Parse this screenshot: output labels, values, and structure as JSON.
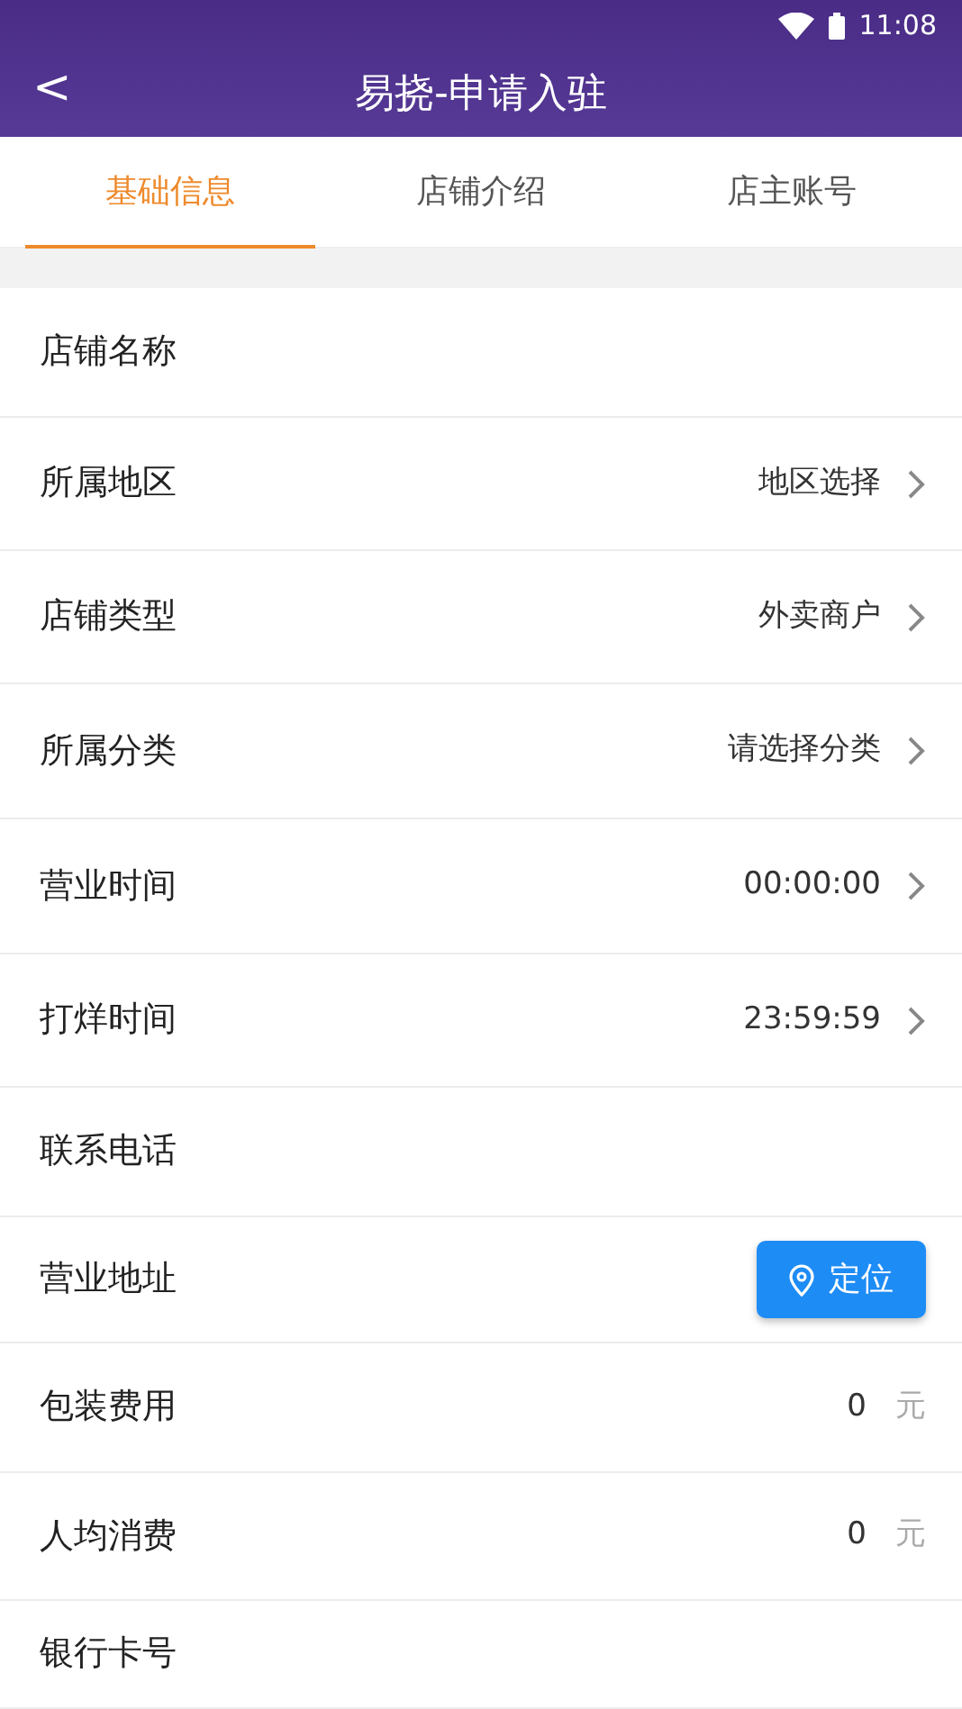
{
  "status_bar": {
    "time": "11:08"
  },
  "header": {
    "back": "<",
    "title": "易挠-申请入驻"
  },
  "tabs": [
    {
      "label": "基础信息",
      "selected": true
    },
    {
      "label": "店铺介绍",
      "selected": false
    },
    {
      "label": "店主账号",
      "selected": false
    }
  ],
  "rows": [
    {
      "kind": "input",
      "label": "店铺名称"
    },
    {
      "kind": "select",
      "label": "所属地区",
      "value": "地区选择"
    },
    {
      "kind": "select",
      "label": "店铺类型",
      "value": "外卖商户"
    },
    {
      "kind": "select",
      "label": "所属分类",
      "value": "请选择分类"
    },
    {
      "kind": "select",
      "label": "营业时间",
      "value": "00:00:00"
    },
    {
      "kind": "select",
      "label": "打烊时间",
      "value": "23:59:59"
    },
    {
      "kind": "input",
      "label": "联系电话"
    },
    {
      "kind": "locate",
      "label": "营业地址",
      "button": "定位"
    },
    {
      "kind": "fee",
      "label": "包装费用",
      "value": "0",
      "unit": "元"
    },
    {
      "kind": "fee",
      "label": "人均消费",
      "value": "0",
      "unit": "元"
    },
    {
      "kind": "input",
      "label": "银行卡号"
    }
  ]
}
